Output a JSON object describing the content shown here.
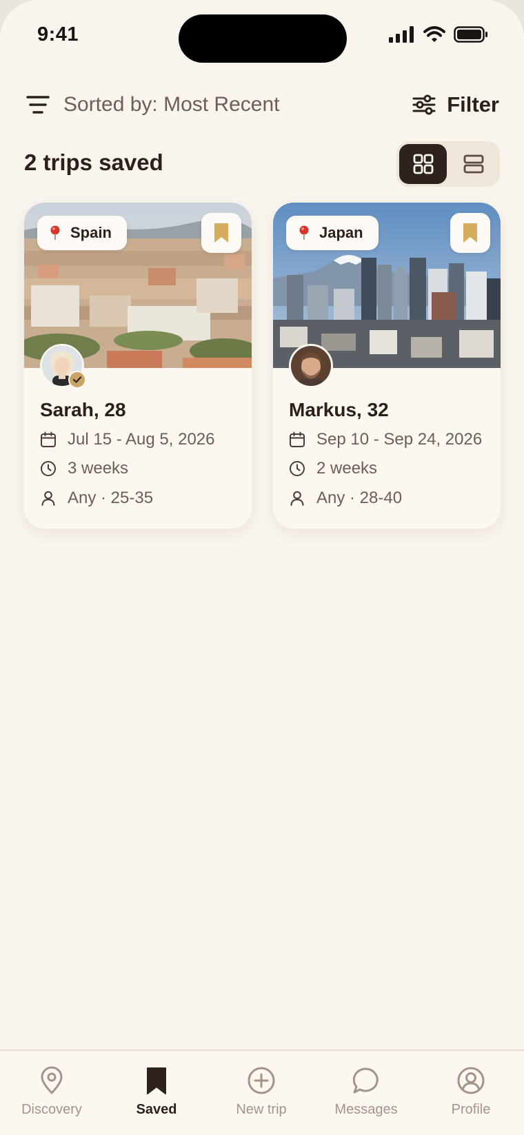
{
  "status_bar": {
    "time": "9:41"
  },
  "toolbar": {
    "sort_label": "Sorted by: Most Recent",
    "filter_label": "Filter"
  },
  "header": {
    "count_title": "2 trips saved",
    "view_modes": [
      "grid",
      "list"
    ],
    "active_view": "grid"
  },
  "trips": [
    {
      "location": "Spain",
      "name_age": "Sarah, 28",
      "dates": "Jul 15 - Aug 5, 2026",
      "duration": "3 weeks",
      "companions": "Any · 25-35",
      "verified": true,
      "saved": true
    },
    {
      "location": "Japan",
      "name_age": "Markus, 32",
      "dates": "Sep 10 - Sep 24, 2026",
      "duration": "2 weeks",
      "companions": "Any · 28-40",
      "verified": false,
      "saved": true
    }
  ],
  "bottom_nav": {
    "active": "Saved",
    "items": [
      {
        "label": "Discovery",
        "icon": "map-pin-icon"
      },
      {
        "label": "Saved",
        "icon": "bookmark-icon"
      },
      {
        "label": "New trip",
        "icon": "plus-circle-icon"
      },
      {
        "label": "Messages",
        "icon": "chat-bubble-icon"
      },
      {
        "label": "Profile",
        "icon": "user-circle-icon"
      }
    ]
  },
  "colors": {
    "background": "#f9f4ed",
    "accent_gold": "#c9a465",
    "text_dark": "#2b211c",
    "text_muted": "#6d5e55"
  }
}
